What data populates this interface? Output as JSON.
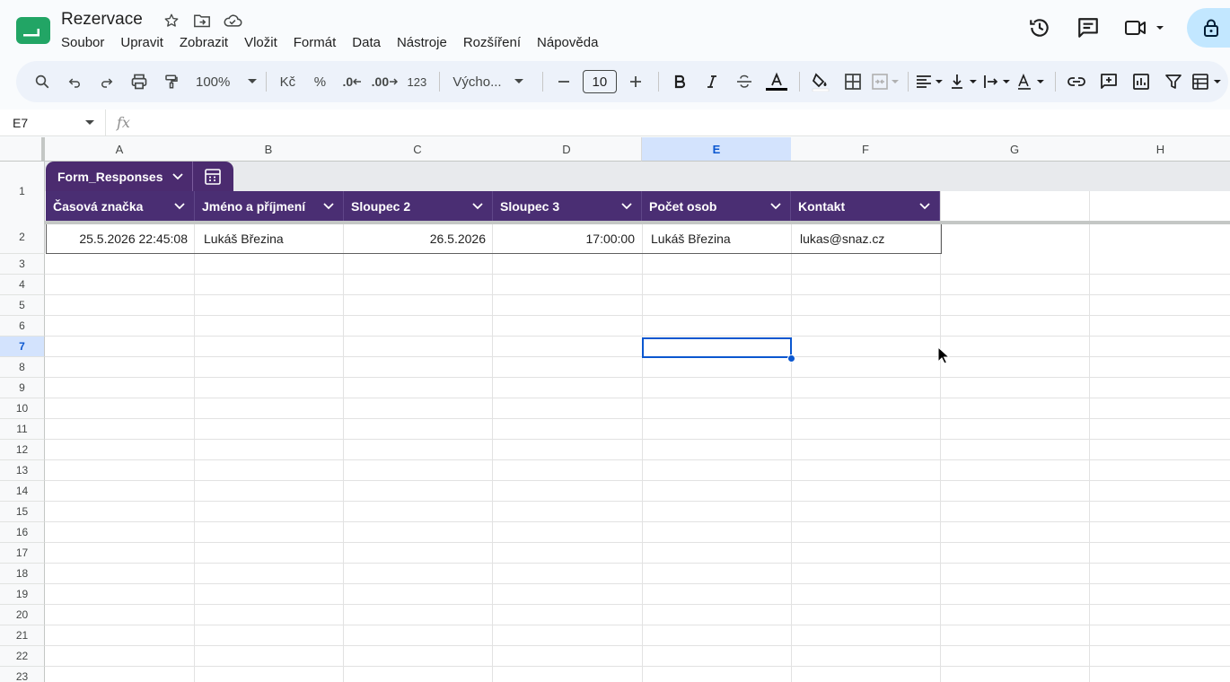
{
  "doc": {
    "title": "Rezervace",
    "menu": [
      "Soubor",
      "Upravit",
      "Zobrazit",
      "Vložit",
      "Formát",
      "Data",
      "Nástroje",
      "Rozšíření",
      "Nápověda"
    ]
  },
  "toolbar": {
    "zoom": "100%",
    "currency": "Kč",
    "percent": "%",
    "dec_less": ".0",
    "dec_more": ".00",
    "number_format": "123",
    "font": "Výcho...",
    "font_size": "10",
    "colors": {
      "bar": "#edf2fa",
      "accent": "#0b57d0",
      "share": "#c2e7ff"
    }
  },
  "formula_bar": {
    "cell_ref": "E7",
    "fx_label": "fx",
    "value": ""
  },
  "columns": [
    "A",
    "B",
    "C",
    "D",
    "E",
    "F",
    "G",
    "H"
  ],
  "selected_column": "E",
  "rows": [
    "1",
    "2",
    "3",
    "4",
    "5",
    "6",
    "7",
    "8",
    "9",
    "10",
    "11",
    "12",
    "13",
    "14",
    "15",
    "16",
    "17",
    "18",
    "19",
    "20",
    "21",
    "22",
    "23"
  ],
  "selected_row": "7",
  "table": {
    "name": "Form_Responses",
    "header_color": "#4a2e73",
    "headers": [
      "Časová značka",
      "Jméno a příjmení",
      "Sloupec 2",
      "Sloupec 3",
      "Počet osob",
      "Kontakt"
    ],
    "data": [
      [
        "25.5.2026 22:45:08",
        "Lukáš Březina",
        "26.5.2026",
        "17:00:00",
        "Lukáš Březina",
        "lukas@snaz.cz"
      ]
    ]
  }
}
